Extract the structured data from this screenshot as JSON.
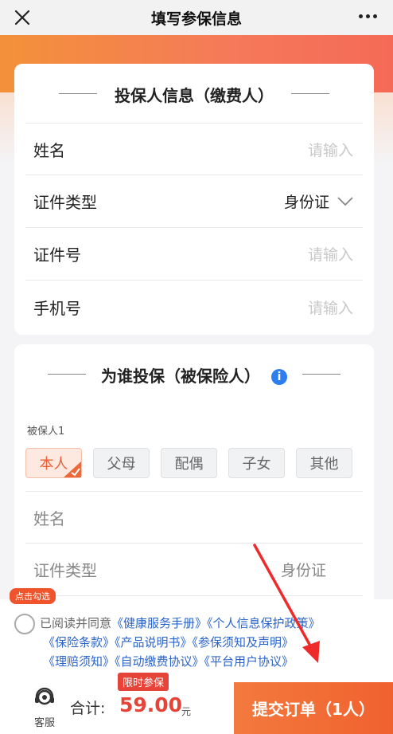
{
  "header": {
    "title": "填写参保信息"
  },
  "policyholder": {
    "title": "投保人信息（缴费人）",
    "fields": {
      "name": {
        "label": "姓名",
        "placeholder": "请输入"
      },
      "id_type": {
        "label": "证件类型",
        "value": "身份证"
      },
      "id_number": {
        "label": "证件号",
        "placeholder": "请输入"
      },
      "phone": {
        "label": "手机号",
        "placeholder": "请输入"
      }
    }
  },
  "insured": {
    "title": "为谁投保（被保险人）",
    "person_label": "被保人1",
    "relations": [
      "本人",
      "父母",
      "配偶",
      "子女",
      "其他"
    ],
    "selected_relation": "本人",
    "fields": {
      "name": {
        "label": "姓名"
      },
      "id_type": {
        "label": "证件类型",
        "value": "身份证"
      }
    }
  },
  "agreement": {
    "tip": "点击勾选",
    "prefix": "已阅读并同意",
    "links": [
      "《健康服务手册》",
      "《个人信息保护政策》",
      "《保险条款》",
      "《产品说明书》",
      "《参保须知及声明》",
      "《理赔须知》",
      "《自动缴费协议》",
      "《平台用户协议》"
    ]
  },
  "footer": {
    "service_label": "客服",
    "total_label": "合计:",
    "badge": "限时参保",
    "amount": "59.00",
    "unit": "元",
    "submit_label": "提交订单（1人）"
  },
  "colors": {
    "accent": "#f0612f",
    "price": "#e64438",
    "link": "#2a63c9"
  }
}
